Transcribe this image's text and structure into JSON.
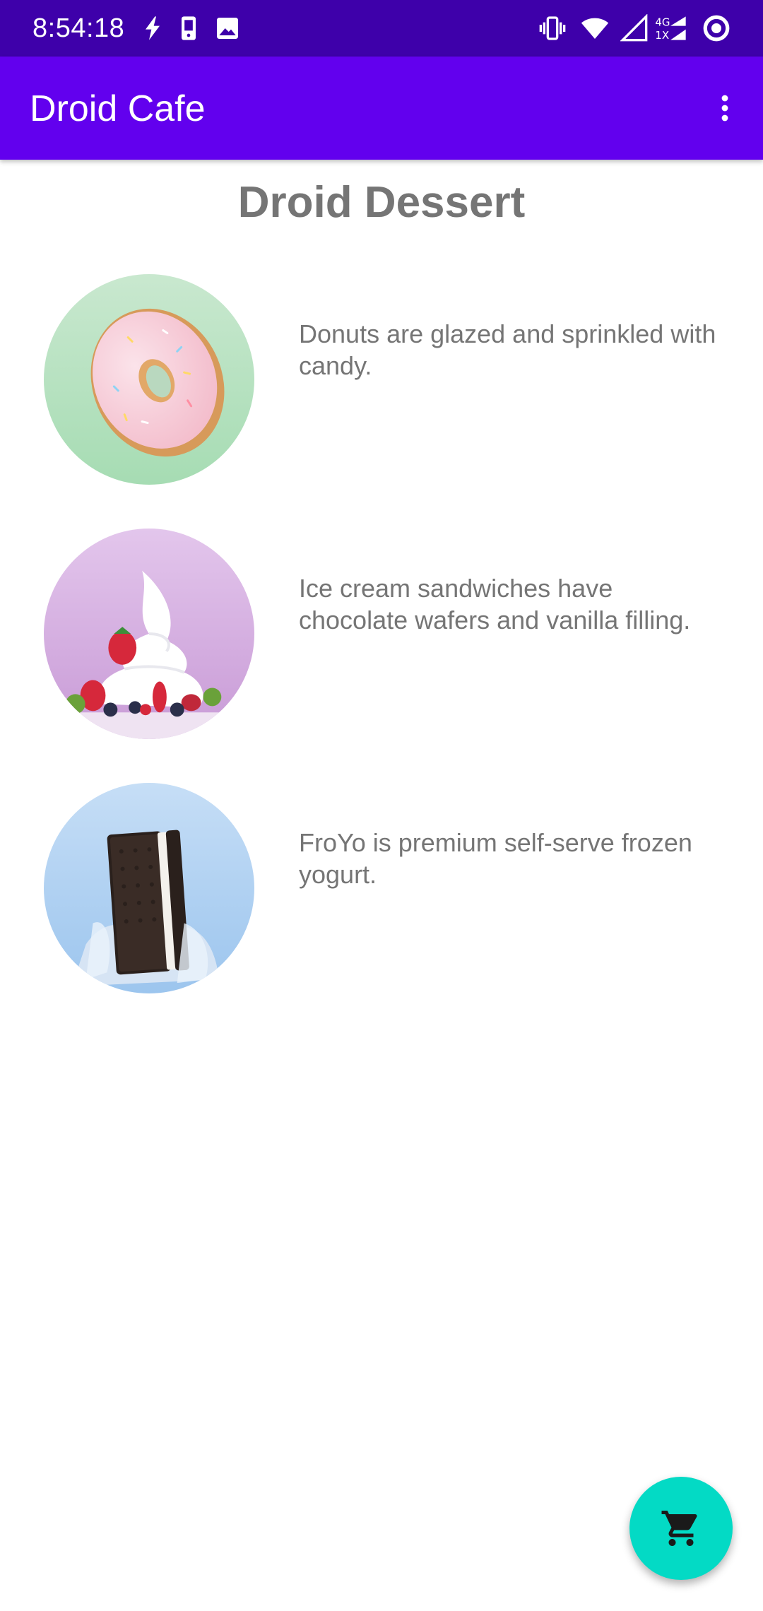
{
  "status_bar": {
    "time": "8:54:18",
    "network_label": "4G 1X",
    "icons": [
      "flash-icon",
      "phone-notification-icon",
      "image-icon",
      "vibrate-icon",
      "wifi-icon",
      "signal-icon",
      "mobile-data-4g-1x-icon",
      "sync-icon"
    ]
  },
  "app_bar": {
    "title": "Droid Cafe",
    "menu_icon": "more-vert-icon"
  },
  "content": {
    "heading": "Droid Dessert",
    "items": [
      {
        "image": "donut-image",
        "text": "Donuts are glazed and sprinkled with candy."
      },
      {
        "image": "ice-cream-sandwich-image",
        "text": "Ice cream sandwiches have chocolate wafers and vanilla filling."
      },
      {
        "image": "froyo-image",
        "text": "FroYo is premium self-serve frozen yogurt."
      }
    ]
  },
  "fab": {
    "icon": "shopping-cart-icon"
  },
  "colors": {
    "status_bar": "#3e00aa",
    "app_bar": "#6200ee",
    "fab": "#03dac5",
    "text_gray": "#757575"
  }
}
